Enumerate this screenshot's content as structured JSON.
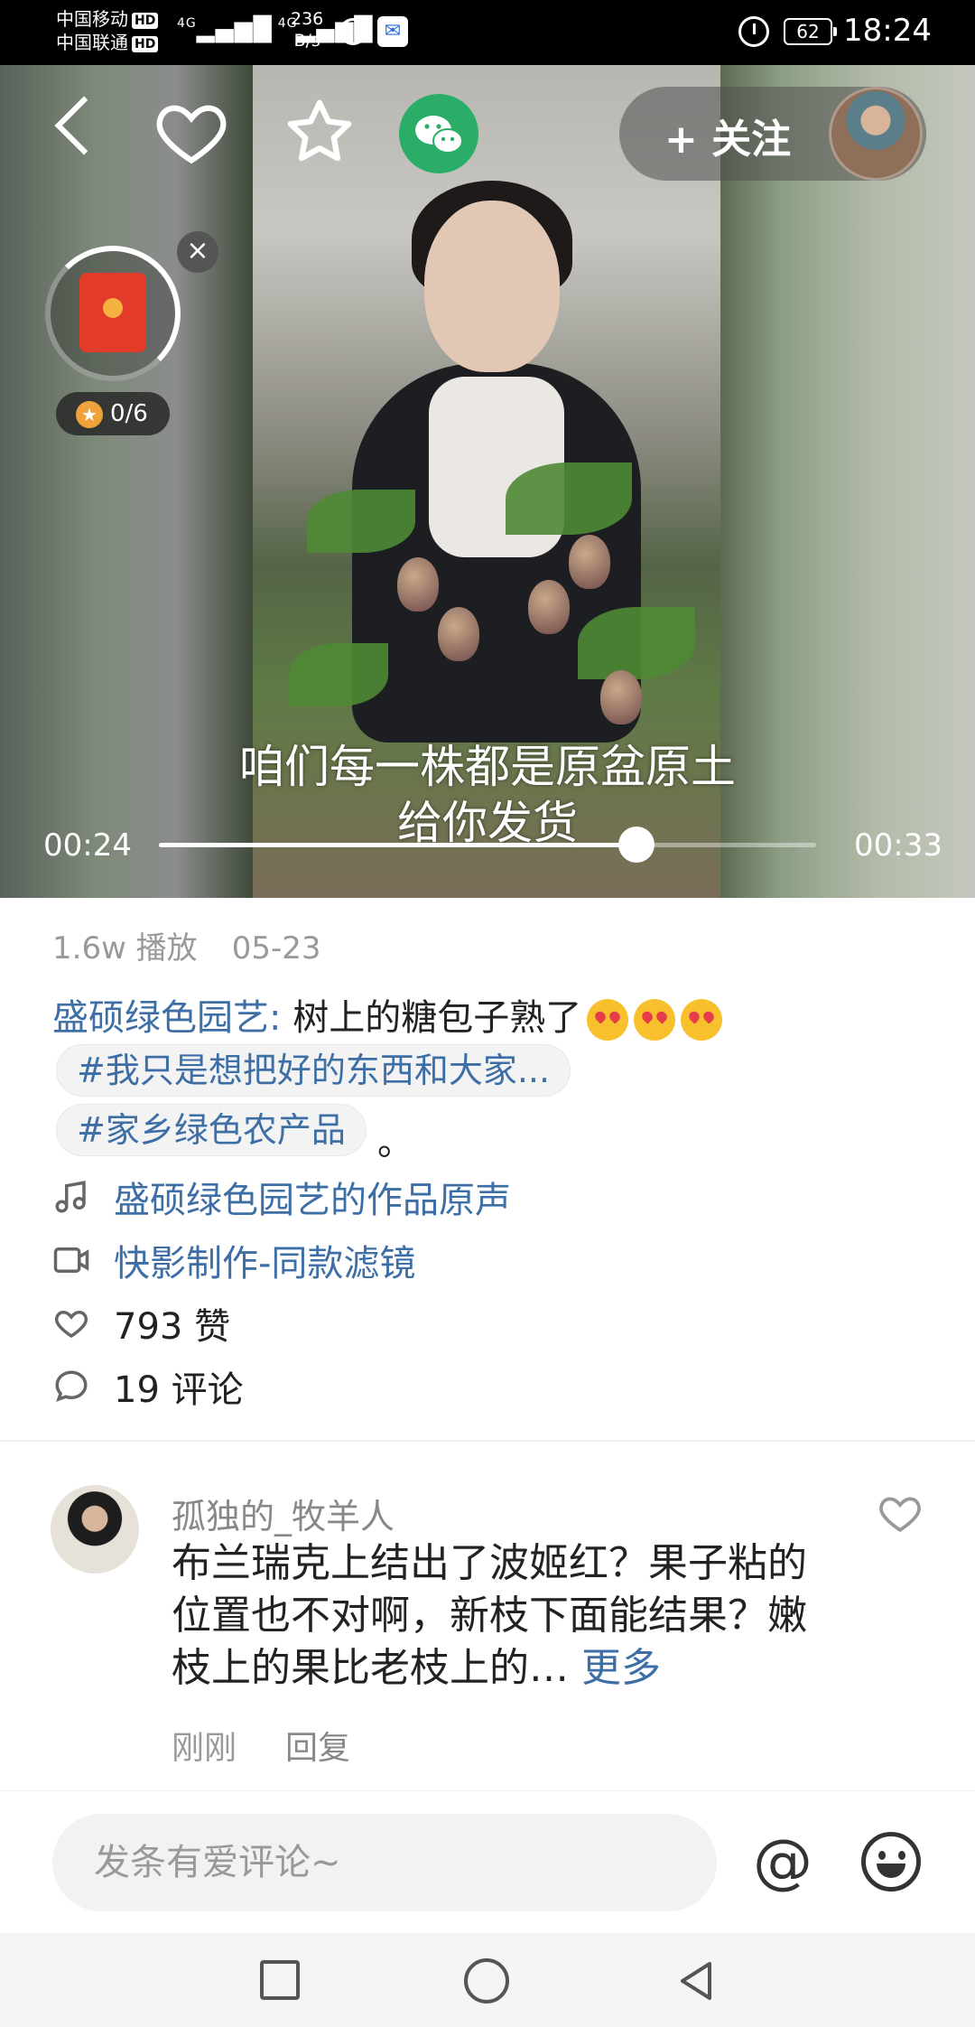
{
  "status_bar": {
    "carrier1": "中国移动",
    "carrier2": "中国联通",
    "hd_label": "HD",
    "network1": "4G",
    "network2": "4G",
    "speed_value": "236",
    "speed_unit": "B/s",
    "battery": "62",
    "time": "18:24"
  },
  "video": {
    "follow_label": "+ 关注",
    "subtitle": "咱们每一株都是原盆原土给你发货",
    "current_time": "00:24",
    "total_time": "00:33",
    "progress_fraction": 0.727,
    "redpacket_count": "0/6",
    "close_glyph": "×"
  },
  "info": {
    "plays": "1.6w 播放",
    "date": "05-23",
    "author": "盛硕绿色园艺:",
    "caption": " 树上的糖包子熟了",
    "tags": [
      "#我只是想把好的东西和大家...",
      "#家乡绿色农产品"
    ],
    "tag_suffix": "。",
    "music": "盛硕绿色园艺的作品原声",
    "filter": "快影制作-同款滤镜",
    "likes": "793 赞",
    "comments": "19 评论"
  },
  "comment": {
    "username": "孤独的_牧羊人",
    "text": "布兰瑞克上结出了波姬红？果子粘的位置也不对啊，新枝下面能结果？嫩枝上的果比老枝上的…",
    "more": "更多",
    "time": "刚刚",
    "reply": "回复"
  },
  "input": {
    "placeholder": "发条有爱评论~",
    "at_glyph": "@"
  },
  "colors": {
    "link": "#3d6fa6",
    "wechat": "#2aae67",
    "redpacket": "#e33b2a"
  }
}
